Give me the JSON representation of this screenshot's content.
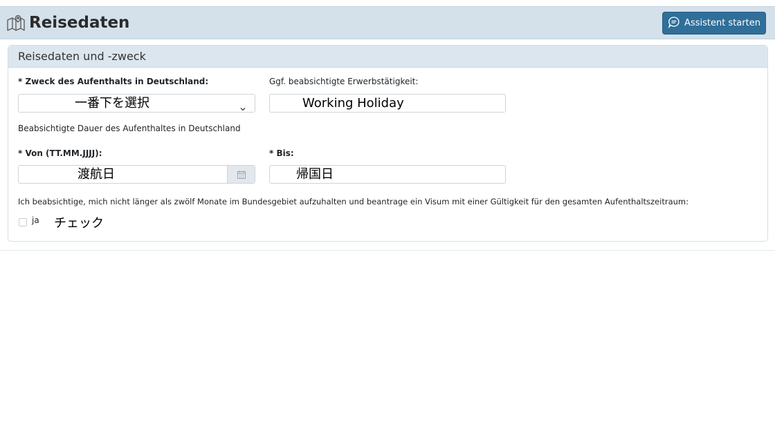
{
  "header": {
    "title": "Reisedaten",
    "assistant_button": "Assistent starten"
  },
  "section": {
    "title": "Reisedaten und -zweck",
    "purpose_label": "* Zweck des Aufenthalts in Deutschland:",
    "purpose_value": "一番下を選択",
    "employment_label": "Ggf. beabsichtigte Erwerbstätigkeit:",
    "employment_value": "Working Holiday",
    "duration_label": "Beabsichtigte Dauer des Aufenthaltes in Deutschland",
    "from_label": "* Von (TT.MM.JJJJ):",
    "from_value": "渡航日",
    "to_label": "* Bis:",
    "to_value": "帰国日",
    "declaration_text": "Ich beabsichtige, mich nicht länger als zwölf Monate im Bundesgebiet aufzuhalten und beantrage ein Visum mit einer Gültigkeit für den gesamten Aufenthaltszeitraum:",
    "checkbox_label": "ja",
    "checkbox_checked": false,
    "checkbox_note": "チェック"
  },
  "icons": {
    "header_icon": "map-icon",
    "assistant_icon": "chat-bubble-icon",
    "select_icon": "chevron-down-icon",
    "date_icon": "calendar-icon"
  },
  "colors": {
    "header_bg": "#d4e1eb",
    "button_bg": "#2f6f99",
    "card_header_bg": "#dbe6ee"
  }
}
